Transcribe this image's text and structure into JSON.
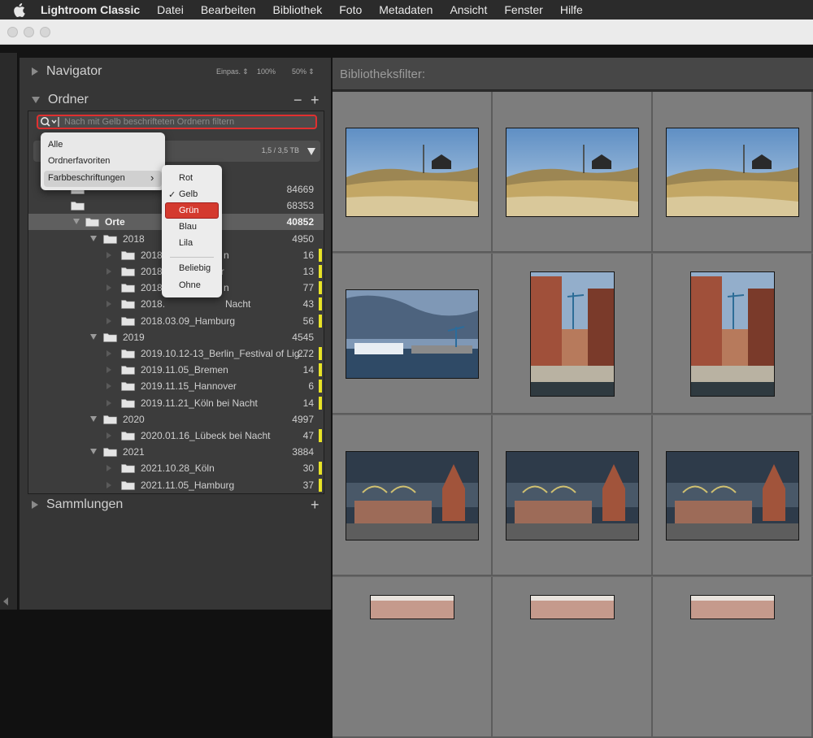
{
  "menubar": {
    "app_name": "Lightroom Classic",
    "items": [
      "Datei",
      "Bearbeiten",
      "Bibliothek",
      "Foto",
      "Metadaten",
      "Ansicht",
      "Fenster",
      "Hilfe"
    ]
  },
  "navigator": {
    "title": "Navigator",
    "zoom_options": [
      "Einpas.",
      "100%",
      "50%"
    ]
  },
  "ordner": {
    "title": "Ordner",
    "search_placeholder": "Nach mit Gelb beschrifteten Ordnern filtern",
    "volume_size": "1,5 / 3,5 TB",
    "rows": [
      {
        "label": "",
        "count": "84669"
      },
      {
        "label": "",
        "count": "68353"
      },
      {
        "label": "Orte",
        "count": "40852"
      },
      {
        "label": "2018",
        "count": "4950"
      },
      {
        "label": "2018.",
        "tail": "n",
        "count": "16"
      },
      {
        "label": "2018.",
        "tail": "er",
        "count": "13"
      },
      {
        "label": "2018.",
        "tail": "n",
        "count": "77"
      },
      {
        "label": "2018.",
        "tail": "Nacht",
        "count": "43"
      },
      {
        "label": "2018.03.09_Hamburg",
        "count": "56"
      },
      {
        "label": "2019",
        "count": "4545"
      },
      {
        "label": "2019.10.12-13_Berlin_Festival of Lig...",
        "count": "272"
      },
      {
        "label": "2019.11.05_Bremen",
        "count": "14"
      },
      {
        "label": "2019.11.15_Hannover",
        "count": "6"
      },
      {
        "label": "2019.11.21_Köln bei Nacht",
        "count": "14"
      },
      {
        "label": "2020",
        "count": "4997"
      },
      {
        "label": "2020.01.16_Lübeck bei Nacht",
        "count": "47"
      },
      {
        "label": "2021",
        "count": "3884"
      },
      {
        "label": "2021.10.28_Köln",
        "count": "30"
      },
      {
        "label": "2021.11.05_Hamburg",
        "count": "37"
      }
    ]
  },
  "filter_menu": {
    "items": [
      "Alle",
      "Ordnerfavoriten",
      "Farbbeschriftungen"
    ]
  },
  "color_menu": {
    "items": [
      "Rot",
      "Gelb",
      "Grün",
      "Blau",
      "Lila",
      "Beliebig",
      "Ohne"
    ],
    "checked": "Gelb",
    "highlighted": "Grün",
    "check_mark": "✓",
    "submenu_arrow": "›"
  },
  "sammlungen": {
    "title": "Sammlungen"
  },
  "library_filter": {
    "label": "Bibliotheksfilter:"
  },
  "colors": {
    "label_yellow": "#e8e326",
    "highlight_red": "#d43a2f"
  }
}
